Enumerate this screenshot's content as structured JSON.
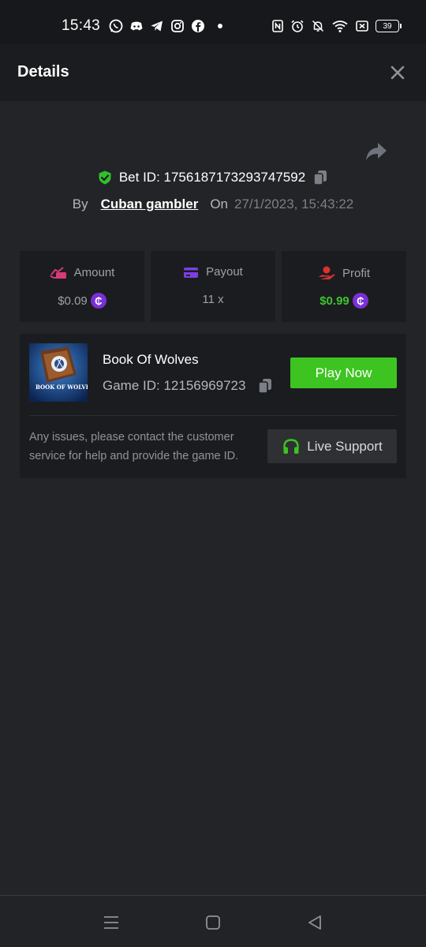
{
  "status_bar": {
    "time": "15:43",
    "battery": "39",
    "app_icons": [
      "whatsapp-icon",
      "discord-icon",
      "telegram-icon",
      "instagram-icon",
      "facebook-icon"
    ],
    "system_icons": [
      "nfc-icon",
      "alarm-icon",
      "mute-icon",
      "wifi-icon",
      "x-icon",
      "battery-icon"
    ]
  },
  "header": {
    "title": "Details"
  },
  "bet": {
    "bet_id_label": "Bet ID: 1756187173293747592",
    "by_label": "By",
    "user": "Cuban gambler",
    "on_label": "On",
    "date": "27/1/2023, 15:43:22"
  },
  "stats": {
    "amount": {
      "label": "Amount",
      "value": "$0.09"
    },
    "payout": {
      "label": "Payout",
      "value": "11 x"
    },
    "profit": {
      "label": "Profit",
      "value": "$0.99"
    },
    "coin_symbol": "₵"
  },
  "game": {
    "name": "Book Of Wolves",
    "game_id_label": "Game ID: 12156969723",
    "thumb_text": "BOOK OF WOLVES",
    "play_label": "Play Now",
    "issues_text": "Any issues, please contact the customer service for help and provide the game ID.",
    "support_label": "Live Support"
  },
  "colors": {
    "background": "#232427",
    "card": "#1b1c1f",
    "accent_green": "#3dc421",
    "coin_purple": "#7b2fd6",
    "amount_icon": "#d63a78",
    "payout_icon": "#7b40e0",
    "profit_icon": "#d93232"
  }
}
